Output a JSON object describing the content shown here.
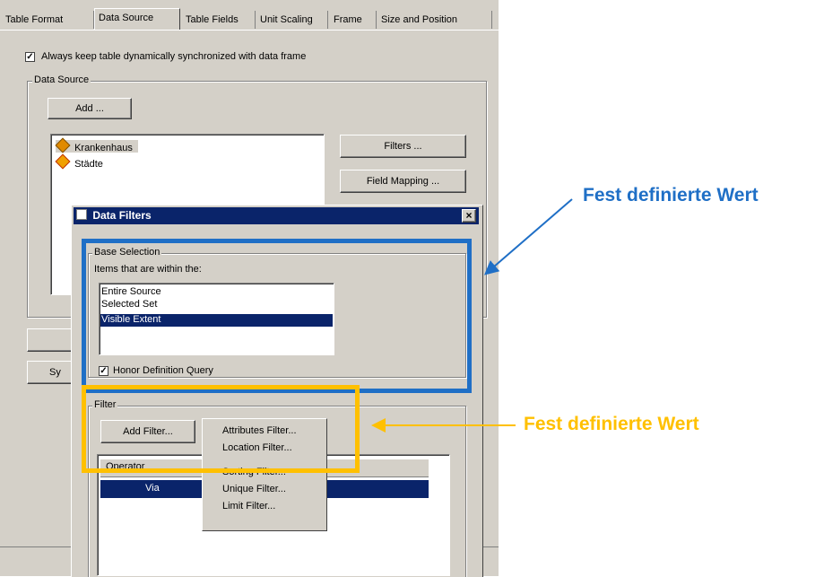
{
  "tabs": [
    "Table Format",
    "Data Source",
    "Table Fields",
    "Unit Scaling",
    "Frame",
    "Size and Position"
  ],
  "sync_checkbox_label": "Always keep table dynamically synchronized with data frame",
  "data_source": {
    "group_label": "Data Source",
    "add_button": "Add ...",
    "layers": [
      "Krankenhaus",
      "Städte"
    ],
    "filters_button": "Filters ...",
    "field_mapping_button": "Field Mapping ...",
    "partial_button": "Sy"
  },
  "dialog": {
    "title": "Data Filters",
    "close_glyph": "×",
    "base_selection": {
      "group_label": "Base Selection",
      "prompt": "Items that are within the:",
      "options": [
        "Entire Source",
        "Selected Set",
        "Visible Extent"
      ],
      "selected_index": 2,
      "honor_label": "Honor Definition Query"
    },
    "filter": {
      "group_label": "Filter",
      "add_filter_button": "Add Filter...",
      "column_header": "Operator",
      "row_value": "Via"
    },
    "menu": [
      "Attributes Filter...",
      "Location Filter...",
      "Sorting Filter...",
      "Unique Filter...",
      "Limit Filter..."
    ]
  },
  "annotations": {
    "blue_label": "Fest definierte Wert",
    "yellow_label": "Fest definierte Wert",
    "blue_color": "#1f6fc6",
    "yellow_color": "#ffc000"
  }
}
